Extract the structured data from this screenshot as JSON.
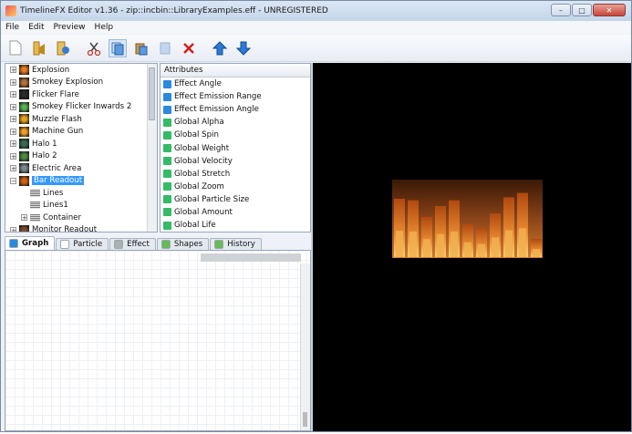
{
  "window": {
    "title": "TimelineFX Editor v1.36 - zip::incbin::LibraryExamples.eff - UNREGISTERED",
    "controls": {
      "minimize": "–",
      "maximize": "□",
      "close": "✕"
    }
  },
  "menu": [
    "File",
    "Edit",
    "Preview",
    "Help"
  ],
  "toolbar": [
    "new-file-icon",
    "open-folder-icon",
    "save-icon",
    "cut-icon",
    "copy-icon",
    "paste-icon",
    "blank-icon",
    "delete-icon",
    "move-up-icon",
    "move-down-icon"
  ],
  "tree": {
    "items": [
      {
        "label": "Explosion",
        "expander": "+",
        "color": "#e87a1e"
      },
      {
        "label": "Smokey Explosion",
        "expander": "+",
        "color": "#b0703a"
      },
      {
        "label": "Flicker Flare",
        "expander": "+",
        "color": "#2a2a2a"
      },
      {
        "label": "Smokey Flicker Inwards 2",
        "expander": "+",
        "color": "#58b052"
      },
      {
        "label": "Muzzle Flash",
        "expander": "+",
        "color": "#e7a21d"
      },
      {
        "label": "Machine Gun",
        "expander": "+",
        "color": "#f0a020"
      },
      {
        "label": "Halo 1",
        "expander": "+",
        "color": "#3a6b52"
      },
      {
        "label": "Halo 2",
        "expander": "+",
        "color": "#4c8a3e"
      },
      {
        "label": "Electric Area",
        "expander": "+",
        "color": "#7a8a8a"
      },
      {
        "label": "Bar Readout",
        "expander": "−",
        "color": "#d06010",
        "selected": true
      },
      {
        "label": "Lines",
        "child": true
      },
      {
        "label": "Lines1",
        "child": true
      },
      {
        "label": "Container",
        "child": true,
        "expander": "+"
      },
      {
        "label": "Monitor Readout",
        "expander": "+",
        "color": "#7a5030"
      }
    ]
  },
  "attributes": {
    "header": "Attributes",
    "items": [
      {
        "label": "Effect Angle",
        "color": "#2a8ae0"
      },
      {
        "label": "Effect Emission Range",
        "color": "#2a8ae0"
      },
      {
        "label": "Effect Emission Angle",
        "color": "#2a8ae0"
      },
      {
        "label": "Global Alpha",
        "color": "#33bb66"
      },
      {
        "label": "Global Spin",
        "color": "#33bb66"
      },
      {
        "label": "Global Weight",
        "color": "#33bb66"
      },
      {
        "label": "Global Velocity",
        "color": "#33bb66"
      },
      {
        "label": "Global Stretch",
        "color": "#33bb66"
      },
      {
        "label": "Global Zoom",
        "color": "#33bb66"
      },
      {
        "label": "Global Particle Size",
        "color": "#33bb66"
      },
      {
        "label": "Global Amount",
        "color": "#33bb66"
      },
      {
        "label": "Global Life",
        "color": "#33bb66"
      }
    ]
  },
  "tabs": [
    {
      "label": "Graph",
      "active": true,
      "color": "#2a8ae0"
    },
    {
      "label": "Particle",
      "color": "#ffffff"
    },
    {
      "label": "Effect",
      "color": "#aab0b8"
    },
    {
      "label": "Shapes",
      "color": "#66bb55"
    },
    {
      "label": "History",
      "color": "#66bb55"
    }
  ],
  "preview": {
    "bars": [
      0.8,
      0.78,
      0.55,
      0.7,
      0.78,
      0.45,
      0.4,
      0.6,
      0.82,
      0.88,
      0.25
    ],
    "accent": "#f0b050"
  }
}
